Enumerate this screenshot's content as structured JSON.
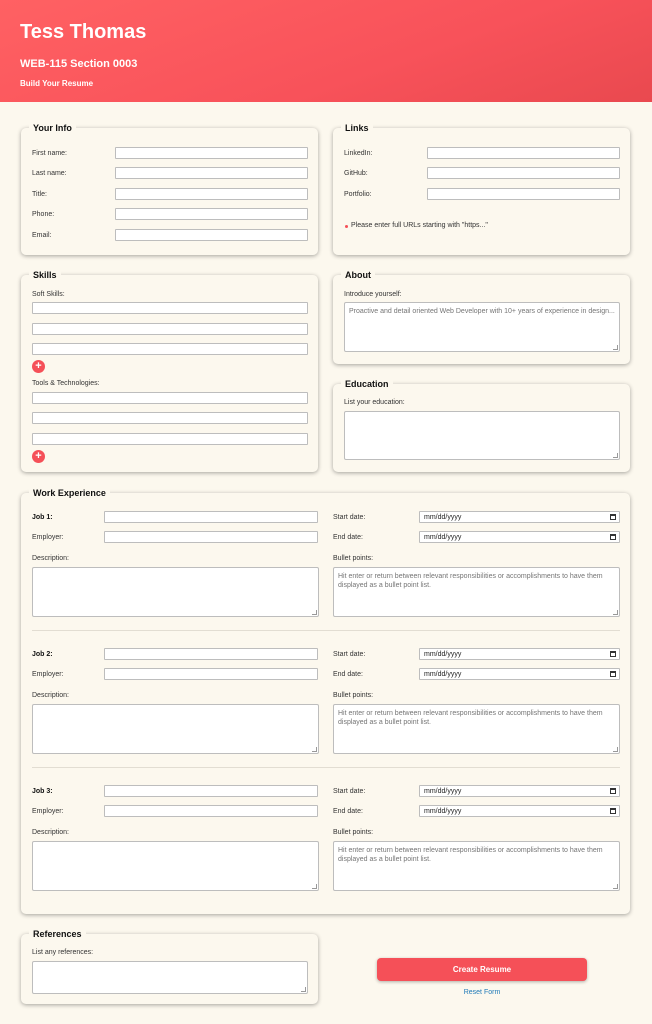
{
  "header": {
    "name": "Tess Thomas",
    "course": "WEB-115 Section 0003",
    "subtitle": "Build Your Resume"
  },
  "your_info": {
    "title": "Your Info",
    "fields": [
      "First name:",
      "Last name:",
      "Title:",
      "Phone:",
      "Email:"
    ]
  },
  "links": {
    "title": "Links",
    "fields": [
      "LinkedIn:",
      "GitHub:",
      "Portfolio:"
    ],
    "note": "Please enter full URLs starting with \"https...\""
  },
  "skills": {
    "title": "Skills",
    "soft_label": "Soft Skills:",
    "tools_label": "Tools & Technologies:",
    "add": "+"
  },
  "about": {
    "title": "About",
    "label": "Introduce yourself:",
    "placeholder": "Proactive and detail oriented Web Developer with 10+ years of experience in design..."
  },
  "education": {
    "title": "Education",
    "label": "List your education:"
  },
  "work": {
    "title": "Work Experience",
    "jobs": [
      {
        "job_label": "Job 1:"
      },
      {
        "job_label": "Job 2:"
      },
      {
        "job_label": "Job 3:"
      }
    ],
    "employer_label": "Employer:",
    "start_label": "Start date:",
    "end_label": "End date:",
    "description_label": "Description:",
    "bullets_label": "Bullet points:",
    "bullets_placeholder": "Hit enter or return between relevant responsibilities or accomplishments to have them displayed as a bullet point list.",
    "date_placeholder": "mm/dd/yyyy"
  },
  "references": {
    "title": "References",
    "label": "List any references:"
  },
  "actions": {
    "create": "Create Resume",
    "reset": "Reset Form"
  },
  "colors": {
    "accent": "#f55058",
    "background": "#fcf8ee",
    "link": "#1f7ab8"
  }
}
